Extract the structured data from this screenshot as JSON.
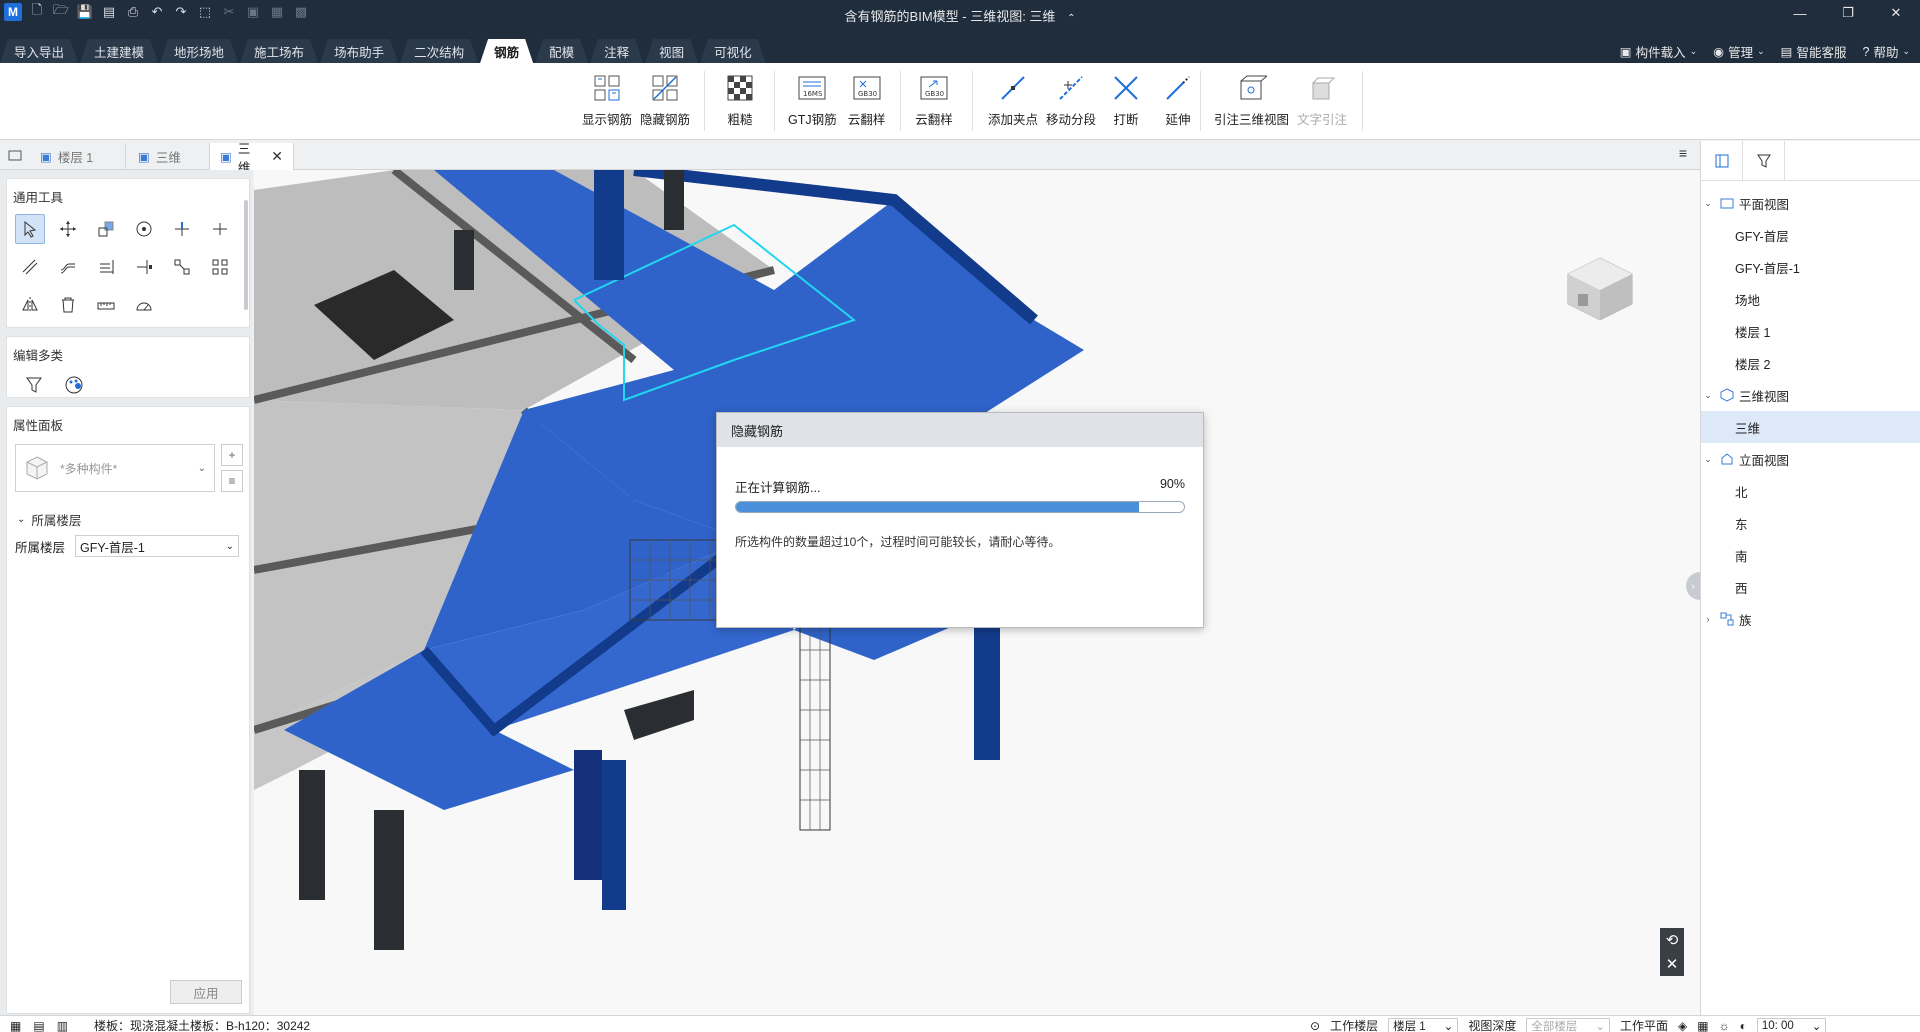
{
  "window": {
    "title": "含有钢筋的BIM模型 - 三维视图: 三维",
    "title_suffix": "⌃"
  },
  "ribbon_tabs": [
    {
      "label": "导入导出",
      "active": false
    },
    {
      "label": "土建建模",
      "active": false
    },
    {
      "label": "地形场地",
      "active": false
    },
    {
      "label": "施工场布",
      "active": false
    },
    {
      "label": "场布助手",
      "active": false
    },
    {
      "label": "二次结构",
      "active": false
    },
    {
      "label": "钢筋",
      "active": true
    },
    {
      "label": "配模",
      "active": false
    },
    {
      "label": "注释",
      "active": false
    },
    {
      "label": "视图",
      "active": false
    },
    {
      "label": "可视化",
      "active": false
    }
  ],
  "ribbon_right": {
    "component_load": "构件载入",
    "manage": "管理",
    "service": "智能客服",
    "help": "帮助"
  },
  "ribbon_buttons": {
    "show_rebar": "显示钢筋",
    "hide_rebar": "隐藏钢筋",
    "rough": "粗糙",
    "gtj_rebar": "GTJ钢筋",
    "cloud_sample_1": "云翻样",
    "cloud_sample_2": "云翻样",
    "add_pinch": "添加夹点",
    "move_segment": "移动分段",
    "break": "打断",
    "extend": "延伸",
    "annotate_3d": "引注三维视图",
    "text_annotate": "文字引注"
  },
  "doc_tabs": [
    {
      "label": "楼层 1",
      "active": false
    },
    {
      "label": "三维",
      "active": false
    },
    {
      "label": "三维",
      "active": true
    }
  ],
  "left_panel": {
    "general_tools": "通用工具",
    "edit_multi": "编辑多类",
    "property_panel": "属性面板",
    "component_placeholder": "*多种构件*",
    "floor_group": "所属楼层",
    "floor_label": "所属楼层",
    "floor_value": "GFY-首层-1",
    "apply": "应用"
  },
  "dialog": {
    "title": "隐藏钢筋",
    "status": "正在计算钢筋...",
    "percent_text": "90%",
    "progress": 0.9,
    "note": "所选构件的数量超过10个，过程时间可能较长，请耐心等待。"
  },
  "tree": {
    "plan_views": "平面视图",
    "plan_items": [
      "GFY-首层",
      "GFY-首层-1",
      "场地",
      "楼层 1",
      "楼层 2"
    ],
    "views_3d": "三维视图",
    "items_3d": [
      "三维"
    ],
    "elevations": "立面视图",
    "elevation_items": [
      "北",
      "东",
      "南",
      "西"
    ],
    "families": "族"
  },
  "status_bar": {
    "selection": "楼板：现浇混凝土楼板：B-h120：30242",
    "work_floor_label": "工作楼层",
    "work_floor_value": "楼层 1",
    "view_depth_label": "视图深度",
    "view_depth_value": "全部楼层",
    "work_plane_label": "工作平面",
    "time_value": "10: 00"
  },
  "colors": {
    "slab_blue": "#2f63c9",
    "dark_blue": "#123b8c",
    "concrete": "#c8c8c8",
    "highlight": "#22d5f0",
    "titlebar": "#1f2d3d"
  }
}
